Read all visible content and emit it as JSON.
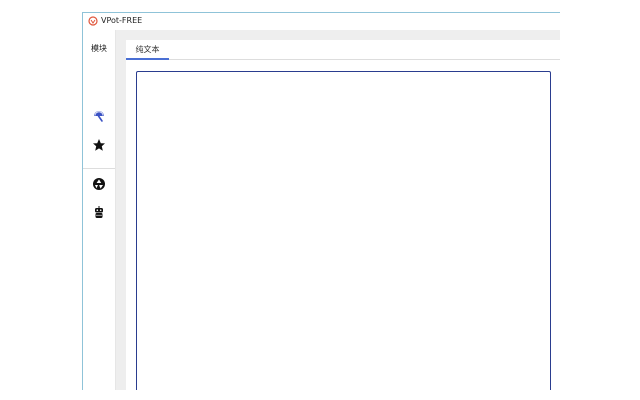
{
  "window": {
    "title": "VPot-FREE",
    "app_icon": "vpot-logo-icon"
  },
  "sidebar": {
    "label": "模块",
    "icons": [
      {
        "name": "pen-tool-icon",
        "color": "#3b52c4"
      },
      {
        "name": "star-icon",
        "color": "#111111"
      },
      {
        "name": "aperture-icon",
        "color": "#111111"
      },
      {
        "name": "robot-icon",
        "color": "#111111"
      }
    ]
  },
  "tabs": [
    {
      "label": "纯文本",
      "active": true
    }
  ],
  "editor": {
    "value": "",
    "border_color": "#2a3d8f"
  }
}
